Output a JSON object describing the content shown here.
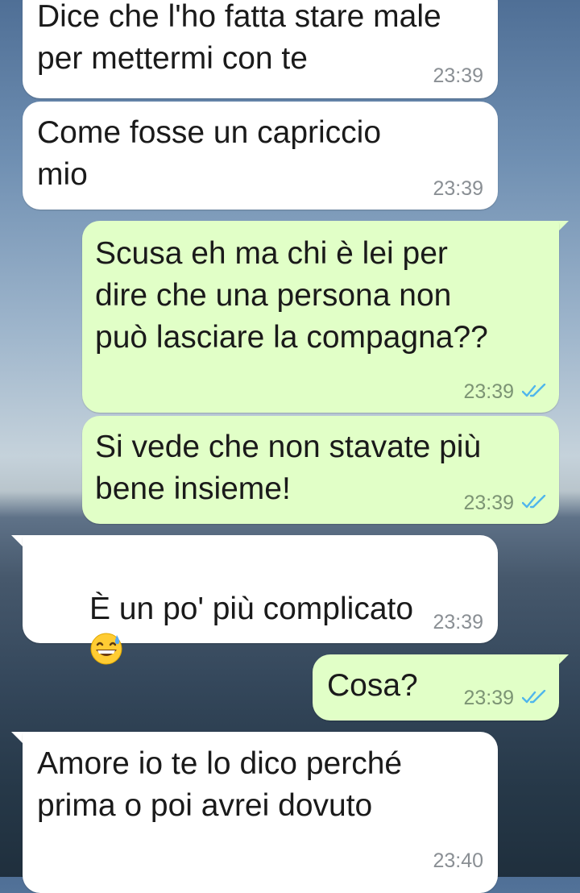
{
  "colors": {
    "incoming_bubble": "#ffffff",
    "outgoing_bubble": "#e1ffc7",
    "read_ticks": "#4fb6ec",
    "timestamp": "#8a8f94"
  },
  "messages": [
    {
      "direction": "incoming",
      "text": "Dice che l'ho fatta stare male\nper mettermi con te",
      "time": "23:39"
    },
    {
      "direction": "incoming",
      "text": "Come fosse un capriccio\nmio",
      "time": "23:39"
    },
    {
      "direction": "outgoing",
      "text": "Scusa eh ma chi è lei per\ndire che una persona non\npuò lasciare la compagna??",
      "time": "23:39",
      "status_icon": "double-check-read-icon"
    },
    {
      "direction": "outgoing",
      "text": "Si vede che non stavate più\nbene insieme!",
      "time": "23:39",
      "status_icon": "double-check-read-icon"
    },
    {
      "direction": "incoming",
      "text": "È un po' più complicato",
      "emoji": "grinning-face-with-sweat-emoji",
      "time": "23:39"
    },
    {
      "direction": "outgoing",
      "text": "Cosa?",
      "time": "23:39",
      "status_icon": "double-check-read-icon"
    },
    {
      "direction": "incoming",
      "text": "Amore io te lo dico perché\nprima o poi avrei dovuto",
      "time": "23:40"
    }
  ]
}
